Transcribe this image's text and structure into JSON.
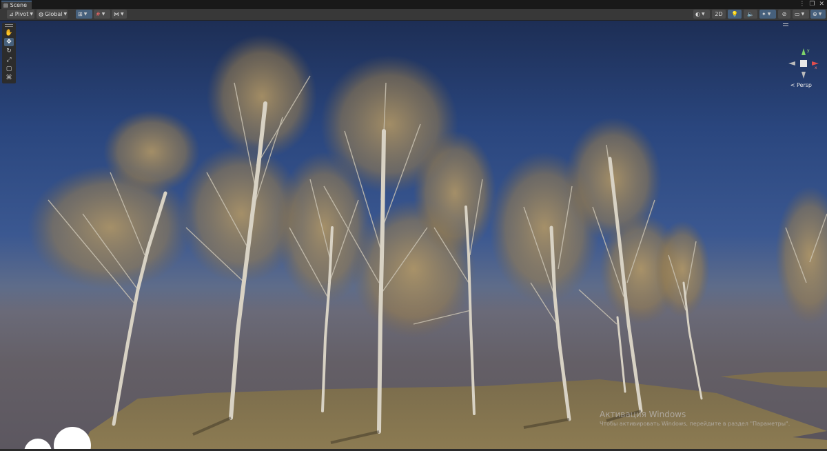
{
  "tab": {
    "title": "Scene"
  },
  "toolbar": {
    "pivot_label": "Pivot",
    "global_label": "Global",
    "mode_2d_label": "2D"
  },
  "gizmo": {
    "y_label": "y",
    "x_label": "x",
    "projection_label": "Persp"
  },
  "watermark": {
    "line1": "Активация Windows",
    "line2": "Чтобы активировать Windows, перейдите в раздел \"Параметры\"."
  },
  "colors": {
    "accent": "#4a8fe0",
    "sky_top": "#1d2e55",
    "horizon": "#6a6a78",
    "ground": "#8a7a52"
  },
  "icons": {
    "toolbar": [
      "pivot-icon",
      "global-icon",
      "grid-snap-icon",
      "grid-icon",
      "increment-snap-icon",
      "shading-mode-icon",
      "lighting-icon",
      "audio-icon",
      "effects-icon",
      "hidden-objects-icon",
      "camera-icon",
      "gizmos-icon"
    ],
    "tools": [
      "hand-tool-icon",
      "move-tool-icon",
      "rotate-tool-icon",
      "scale-tool-icon",
      "rect-tool-icon",
      "transform-tool-icon"
    ]
  }
}
